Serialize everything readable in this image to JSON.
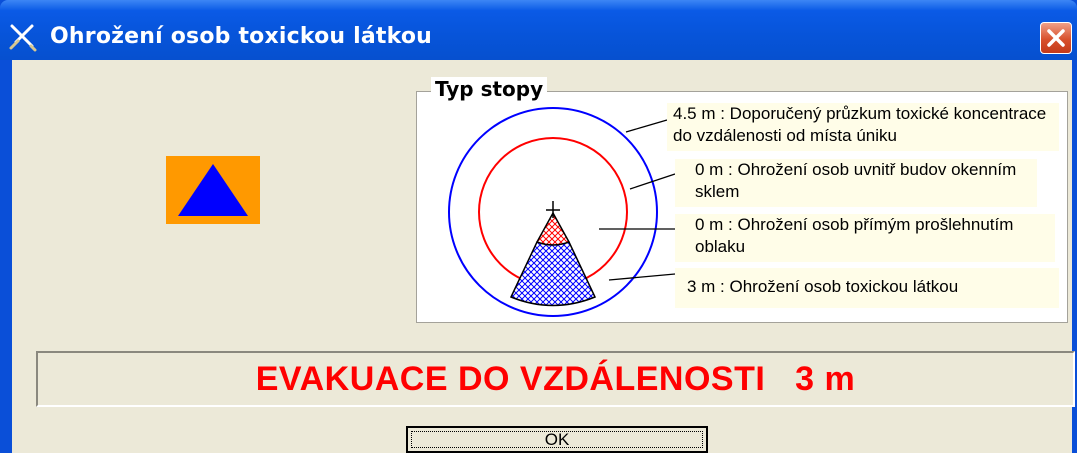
{
  "window": {
    "title": "Ohrožení osob toxickou látkou",
    "close_icon": "close-x"
  },
  "hazard_icon": {
    "name": "warning-triangle",
    "background": "#ff9900",
    "triangle_color": "#0000ff"
  },
  "trace_group": {
    "label": "Typ stopy",
    "notes": [
      {
        "text": "4.5 m : Doporučený průzkum toxické koncentrace do vzdálenosti od místa úniku",
        "color": "#0000ff"
      },
      {
        "text": "0 m : Ohrožení osob uvnitř budov okenním sklem",
        "color": "#ff0000"
      },
      {
        "text": "0 m : Ohrožení osob přímým prošlehnutím oblaku",
        "color": "#ff0000"
      },
      {
        "text": "3 m : Ohrožení osob toxickou látkou",
        "color": "#0000ff"
      }
    ]
  },
  "evacuation": {
    "text": "EVAKUACE DO VZDÁLENOSTI   3 m",
    "color": "#ff0000"
  },
  "buttons": {
    "ok_label": "OK"
  }
}
